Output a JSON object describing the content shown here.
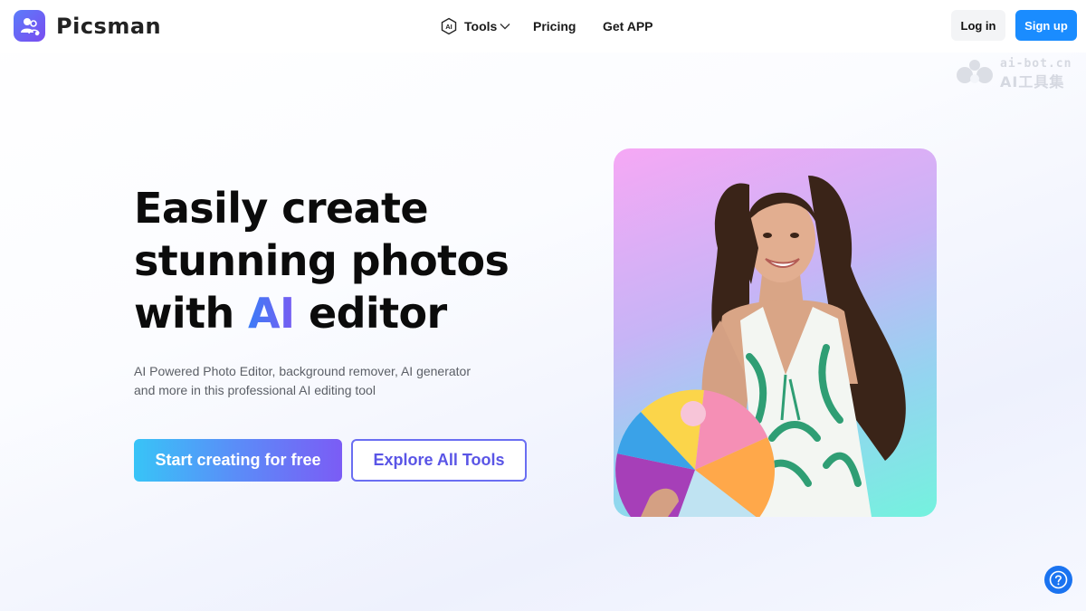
{
  "brand": {
    "name": "Picsman"
  },
  "nav": {
    "tools": {
      "label": "Tools",
      "icon": "ai-chip-icon",
      "chevron": "chevron-down-icon"
    },
    "pricing": "Pricing",
    "get_app": "Get APP"
  },
  "auth": {
    "login": "Log in",
    "signup": "Sign up"
  },
  "watermark": {
    "line1": "ai-bot.cn",
    "line2": "AI工具集"
  },
  "hero": {
    "title_line1": "Easily create",
    "title_line2": "stunning photos",
    "title_line3_pre": "with ",
    "title_line3_highlight": "AI",
    "title_line3_post": " editor",
    "subtitle_line1": "AI Powered Photo Editor, background remover, AI generator",
    "subtitle_line2": "and more in this professional AI editing tool",
    "cta_primary": "Start creating for free",
    "cta_secondary": "Explore All Tools"
  },
  "help": {
    "icon": "question-mark-icon"
  },
  "colors": {
    "accent": "#1a8cff",
    "cta_start": "#38c4f7",
    "cta_end": "#7b5cf5",
    "secondary_border": "#6a6ef2",
    "help": "#1a73f0"
  }
}
